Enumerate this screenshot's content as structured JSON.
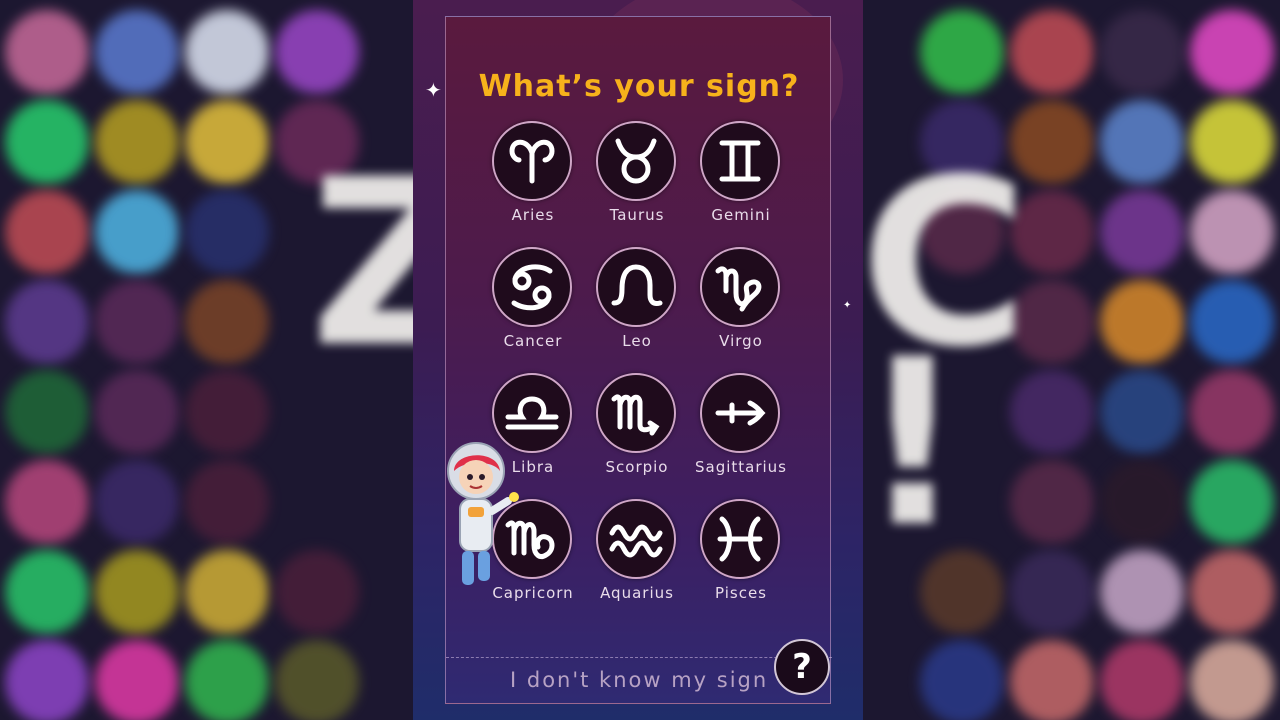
{
  "title": "What’s your sign?",
  "signs": [
    {
      "label": "Aries",
      "icon": "aries-icon"
    },
    {
      "label": "Taurus",
      "icon": "taurus-icon"
    },
    {
      "label": "Gemini",
      "icon": "gemini-icon"
    },
    {
      "label": "Cancer",
      "icon": "cancer-icon"
    },
    {
      "label": "Leo",
      "icon": "leo-icon"
    },
    {
      "label": "Virgo",
      "icon": "virgo-icon"
    },
    {
      "label": "Libra",
      "icon": "libra-icon"
    },
    {
      "label": "Scorpio",
      "icon": "scorpio-icon"
    },
    {
      "label": "Sagittarius",
      "icon": "sagittarius-icon"
    },
    {
      "label": "Capricorn",
      "icon": "capricorn-icon"
    },
    {
      "label": "Aquarius",
      "icon": "aquarius-icon"
    },
    {
      "label": "Pisces",
      "icon": "pisces-icon"
    }
  ],
  "footer": {
    "unknown_label": "I don't know my sign"
  },
  "help": {
    "label": "?"
  },
  "colors": {
    "title": "#f7b21b",
    "icon_bg": "#1f0b1c",
    "icon_ring": "#cfa6c7"
  }
}
